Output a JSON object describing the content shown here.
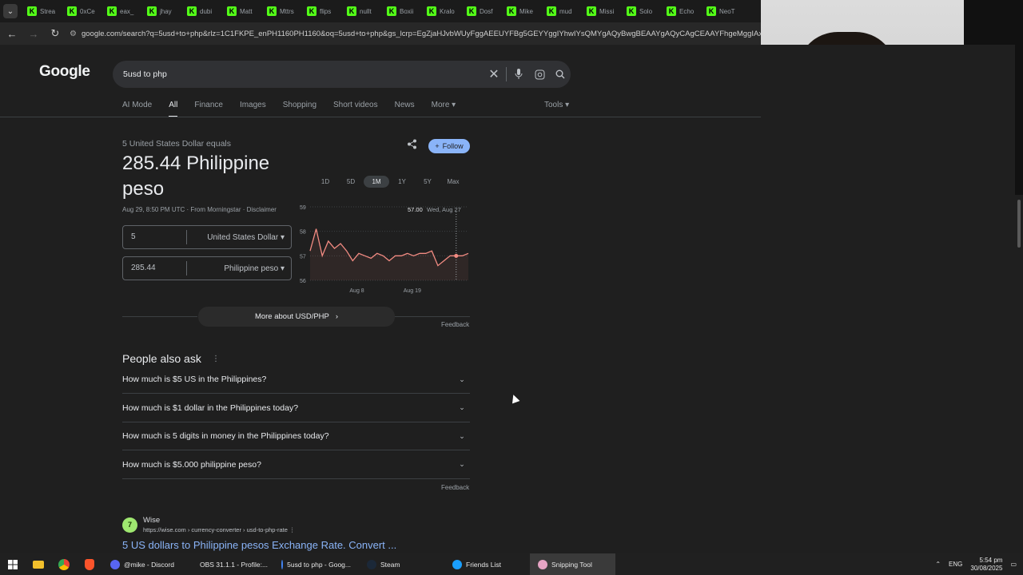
{
  "browser": {
    "tabs": [
      "Strea",
      "0xCe",
      "eax_",
      "jhay",
      "dubi",
      "Matt",
      "Mttrs",
      "flips",
      "nullt",
      "Boxii",
      "Kralo",
      "Dosf",
      "Mike",
      "mud",
      "Missi",
      "Solo",
      "Echo",
      "NeoT"
    ],
    "url": "google.com/search?q=5usd+to+php&rlz=1C1FKPE_enPH1160PH1160&oq=5usd+to+php&gs_lcrp=EgZjaHJvbWUyFggAEEUYFBg5GEYYggIYhwIYsQMYgAQyBwgBEAAYgAQyCAgCEAAYFhgeMggIAxAAGBYY"
  },
  "search": {
    "logo": "Google",
    "query": "5usd to php",
    "tabs": [
      "AI Mode",
      "All",
      "Finance",
      "Images",
      "Shopping",
      "Short videos",
      "News",
      "More"
    ],
    "active_tab": "All",
    "tools": "Tools"
  },
  "converter": {
    "equals_label": "5 United States Dollar equals",
    "result": "285.44 Philippine peso",
    "timestamp": "Aug 29, 8:50 PM UTC · From Morningstar · Disclaimer",
    "follow": "Follow",
    "from_amount": "5",
    "from_currency": "United States Dollar",
    "to_amount": "285.44",
    "to_currency": "Philippine peso",
    "ranges": [
      "1D",
      "5D",
      "1M",
      "1Y",
      "5Y",
      "Max"
    ],
    "active_range": "1M",
    "more_button": "More about USD/PHP",
    "feedback": "Feedback"
  },
  "chart_data": {
    "type": "line",
    "title": "",
    "ylim": [
      56,
      59
    ],
    "yticks": [
      "59",
      "58",
      "57",
      "56"
    ],
    "xticks": [
      "Aug 8",
      "Aug 19"
    ],
    "tooltip": {
      "value": "57.00",
      "date": "Wed, Aug 27"
    },
    "values": [
      57.2,
      58.1,
      57.0,
      57.6,
      57.3,
      57.5,
      57.2,
      56.8,
      57.1,
      57.0,
      56.9,
      57.1,
      57.0,
      56.8,
      57.0,
      57.0,
      57.1,
      57.0,
      57.1,
      57.1,
      57.2,
      56.6,
      56.8,
      57.0,
      57.0,
      57.0,
      57.1
    ],
    "color": "#f28b82"
  },
  "paa": {
    "title": "People also ask",
    "questions": [
      "How much is $5 US in the Philippines?",
      "How much is $1 dollar in the Philippines today?",
      "How much is 5 digits in money in the Philippines today?",
      "How much is $5.000 philippine peso?"
    ],
    "feedback": "Feedback"
  },
  "result": {
    "source": "Wise",
    "url": "https://wise.com › currency-converter › usd-to-php-rate",
    "title": "5 US dollars to Philippine pesos Exchange Rate. Convert ..."
  },
  "taskbar": {
    "apps": [
      "@mike - Discord",
      "OBS 31.1.1 - Profile:...",
      "5usd to php - Goog...",
      "Steam",
      "Friends List",
      "Snipping Tool"
    ],
    "active_app": "Snipping Tool",
    "lang": "ENG",
    "time": "5:54 pm",
    "date": "30/08/2025"
  },
  "colors": {
    "accent": "#8ab4f8",
    "chart_line": "#f28b82",
    "kick_green": "#53fc18"
  }
}
